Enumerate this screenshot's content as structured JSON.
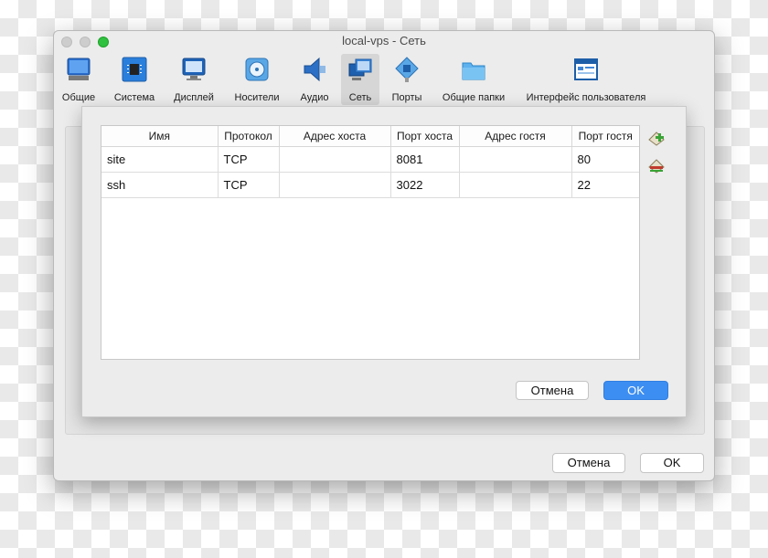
{
  "window": {
    "title": "local-vps - Сеть"
  },
  "toolbar": {
    "items": [
      {
        "label": "Общие",
        "icon": "general-icon"
      },
      {
        "label": "Система",
        "icon": "system-chip-icon"
      },
      {
        "label": "Дисплей",
        "icon": "display-monitor-icon"
      },
      {
        "label": "Носители",
        "icon": "storage-disk-icon"
      },
      {
        "label": "Аудио",
        "icon": "speaker-icon"
      },
      {
        "label": "Сеть",
        "icon": "network-icon"
      },
      {
        "label": "Порты",
        "icon": "ports-connector-icon"
      },
      {
        "label": "Общие папки",
        "icon": "shared-folder-icon"
      },
      {
        "label": "Интерфейс пользователя",
        "icon": "user-interface-icon"
      }
    ],
    "selected": "Сеть"
  },
  "dialog": {
    "columns": [
      "Имя",
      "Протокол",
      "Адрес хоста",
      "Порт хоста",
      "Адрес гостя",
      "Порт гостя"
    ],
    "rows": [
      [
        "site",
        "TCP",
        "",
        "8081",
        "",
        "80"
      ],
      [
        "ssh",
        "TCP",
        "",
        "3022",
        "",
        "22"
      ]
    ],
    "side_icons": [
      "add-rule-icon",
      "remove-rule-icon"
    ],
    "cancel_label": "Отмена",
    "ok_label": "OK"
  },
  "footer": {
    "cancel_label": "Отмена",
    "ok_label": "OK"
  },
  "colors": {
    "accent": "#3d8ef2",
    "maximize": "#2fc13f",
    "add_icon": "#3aa336"
  }
}
